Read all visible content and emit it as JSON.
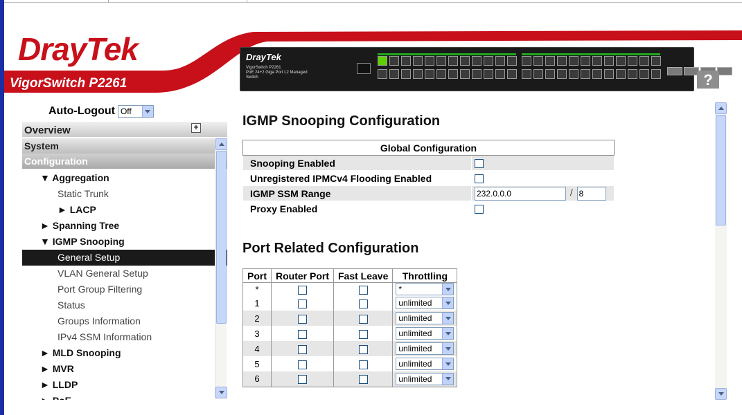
{
  "brand": {
    "logo_dray": "Dray",
    "logo_tek": "Tek",
    "model": "VigorSwitch P2261",
    "switch_brand": "DrayTek",
    "switch_sub": "VigorSwitch P2261\nPoE 24+2 Giga Port L2 Managed Switch"
  },
  "help": {
    "label": "?"
  },
  "sidebar": {
    "auto_logout_label": "Auto-Logout",
    "auto_logout_value": "Off",
    "overview": "Overview",
    "expand_all": "+",
    "system": "System",
    "configuration": "Configuration",
    "items": [
      {
        "label": "▼ Aggregation",
        "level": "l1"
      },
      {
        "label": "Static Trunk",
        "level": "l2"
      },
      {
        "label": "► LACP",
        "level": "l2b"
      },
      {
        "label": "► Spanning Tree",
        "level": "l1"
      },
      {
        "label": "▼ IGMP Snooping",
        "level": "l1"
      },
      {
        "label": "General Setup",
        "level": "l2",
        "active": true
      },
      {
        "label": "VLAN General Setup",
        "level": "l2"
      },
      {
        "label": "Port Group Filtering",
        "level": "l2"
      },
      {
        "label": "Status",
        "level": "l2"
      },
      {
        "label": "Groups Information",
        "level": "l2"
      },
      {
        "label": "IPv4 SSM Information",
        "level": "l2"
      },
      {
        "label": "► MLD Snooping",
        "level": "l1"
      },
      {
        "label": "► MVR",
        "level": "l1"
      },
      {
        "label": "► LLDP",
        "level": "l1"
      },
      {
        "label": "► PoE",
        "level": "l1"
      }
    ]
  },
  "main": {
    "title": "IGMP Snooping Configuration",
    "global": {
      "header": "Global Configuration",
      "snooping_enabled": "Snooping Enabled",
      "unreg_flooding": "Unregistered IPMCv4 Flooding Enabled",
      "ssm_range": "IGMP SSM Range",
      "ssm_address": "232.0.0.0",
      "ssm_separator": "/",
      "ssm_prefix": "8",
      "proxy_enabled": "Proxy Enabled"
    },
    "port_section_title": "Port Related Configuration",
    "ports": {
      "headers": [
        "Port",
        "Router Port",
        "Fast Leave",
        "Throttling"
      ],
      "rows": [
        {
          "port": "*",
          "throttling": "*"
        },
        {
          "port": "1",
          "throttling": "unlimited"
        },
        {
          "port": "2",
          "throttling": "unlimited"
        },
        {
          "port": "3",
          "throttling": "unlimited"
        },
        {
          "port": "4",
          "throttling": "unlimited"
        },
        {
          "port": "5",
          "throttling": "unlimited"
        },
        {
          "port": "6",
          "throttling": "unlimited"
        }
      ]
    }
  },
  "colors": {
    "brand_red": "#c8101a",
    "active_nav": "#1a1a1a",
    "page_edge": "#1b2fa5"
  }
}
